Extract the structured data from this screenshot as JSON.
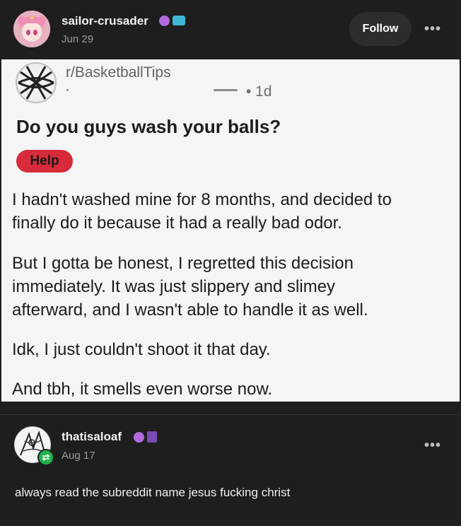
{
  "post": {
    "username": "sailor-crusader",
    "date": "Jun 29",
    "follow_label": "Follow",
    "more_label": "•••"
  },
  "screenshot": {
    "subreddit": "r/BasketballTips",
    "meta_time": "• 1d",
    "title": "Do you guys wash your balls?",
    "flair": "Help",
    "paragraphs": [
      "I hadn't washed mine for 8 months, and decided to\nfinally do it because it had a really bad odor.",
      "But I gotta be honest, I regretted this decision\nimmediately. It was just slippery and slimey\nafterward, and I wasn't able to handle it as well.",
      "Idk, I just couldn't shoot it that day.",
      "And tbh, it smells even worse now."
    ]
  },
  "reblog": {
    "username": "thatisaloaf",
    "date": "Aug 17",
    "more_label": "•••",
    "comment": "always read the subreddit name jesus fucking christ"
  },
  "colors": {
    "background": "#1e1e1e",
    "follow_button": "#2d2d2d",
    "flair": "#d72b3a",
    "reblog_icon": "#22b14c"
  }
}
